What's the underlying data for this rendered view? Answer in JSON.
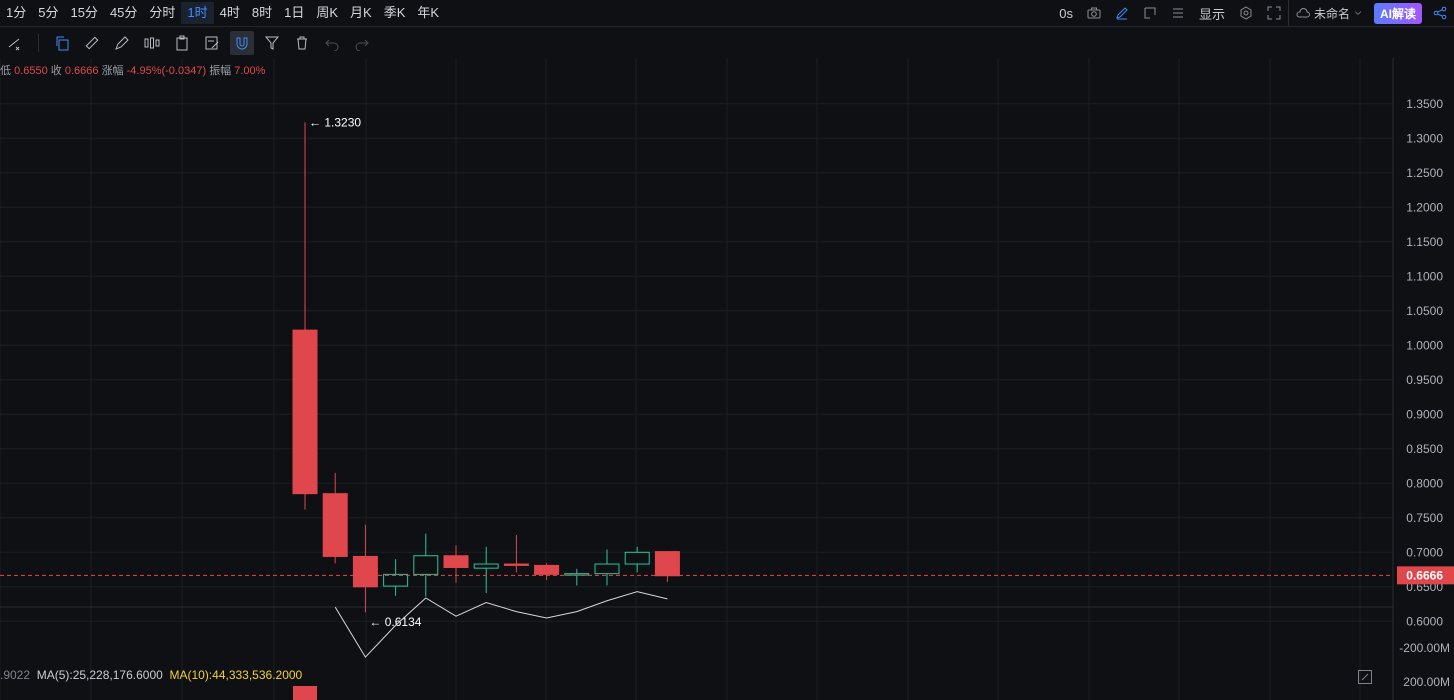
{
  "timeframes": [
    "1分",
    "5分",
    "15分",
    "45分",
    "分时",
    "1时",
    "4时",
    "8时",
    "1日",
    "周K",
    "月K",
    "季K",
    "年K"
  ],
  "active_timeframe": "1时",
  "topright": {
    "countdown": "0s",
    "display_label": "显示",
    "layout_name": "未命名",
    "ai_label": "AI解读"
  },
  "info_bar": {
    "low_label": "低",
    "low_value": "0.6550",
    "close_label": "收",
    "close_value": "0.6666",
    "change_label": "涨幅",
    "change_value": "-4.95%(-0.0347)",
    "amplitude_label": "振幅",
    "amplitude_value": "7.00%"
  },
  "colors": {
    "up": "#26c6a0",
    "down": "#e0474c",
    "background": "#0f1013",
    "grid": "#1c1e23",
    "accent": "#3d8bff",
    "price_line": "#e0474c"
  },
  "chart_data": {
    "type": "candlestick",
    "ylim": [
      0.57,
      1.37
    ],
    "yticks": [
      "1.3500",
      "1.3000",
      "1.2500",
      "1.2000",
      "1.1500",
      "1.1000",
      "1.0500",
      "1.0000",
      "0.9500",
      "0.9000",
      "0.8500",
      "0.8000",
      "0.7500",
      "0.7000",
      "0.6500",
      "0.6000"
    ],
    "last_price": "0.6666",
    "high_marker": "1.3230",
    "low_marker": "0.6134",
    "candles": [
      {
        "open": 1.022,
        "close": 0.785,
        "high": 1.323,
        "low": 0.762
      },
      {
        "open": 0.785,
        "close": 0.694,
        "high": 0.815,
        "low": 0.684
      },
      {
        "open": 0.694,
        "close": 0.65,
        "high": 0.74,
        "low": 0.613
      },
      {
        "open": 0.651,
        "close": 0.668,
        "high": 0.69,
        "low": 0.637
      },
      {
        "open": 0.668,
        "close": 0.695,
        "high": 0.727,
        "low": 0.636
      },
      {
        "open": 0.695,
        "close": 0.678,
        "high": 0.71,
        "low": 0.656
      },
      {
        "open": 0.677,
        "close": 0.683,
        "high": 0.708,
        "low": 0.641
      },
      {
        "open": 0.683,
        "close": 0.681,
        "high": 0.725,
        "low": 0.671
      },
      {
        "open": 0.681,
        "close": 0.668,
        "high": 0.684,
        "low": 0.66
      },
      {
        "open": 0.667,
        "close": 0.669,
        "high": 0.676,
        "low": 0.652
      },
      {
        "open": 0.669,
        "close": 0.683,
        "high": 0.704,
        "low": 0.652
      },
      {
        "open": 0.683,
        "close": 0.7,
        "high": 0.708,
        "low": 0.671
      },
      {
        "open": 0.701,
        "close": 0.666,
        "high": 0.702,
        "low": 0.657
      }
    ],
    "volume_ma5_line": [
      -155,
      -210,
      -175,
      -145,
      -165,
      -150,
      -160,
      -167,
      -160,
      -148,
      -138,
      -146
    ],
    "volume_axis_ticks": [
      "-200.00M",
      "200.00M"
    ],
    "volume_indicators": {
      "left_value": ".9022",
      "ma5_label": "MA(5):25,228,176.6000",
      "ma10_label": "MA(10):44,333,536.2000"
    }
  }
}
